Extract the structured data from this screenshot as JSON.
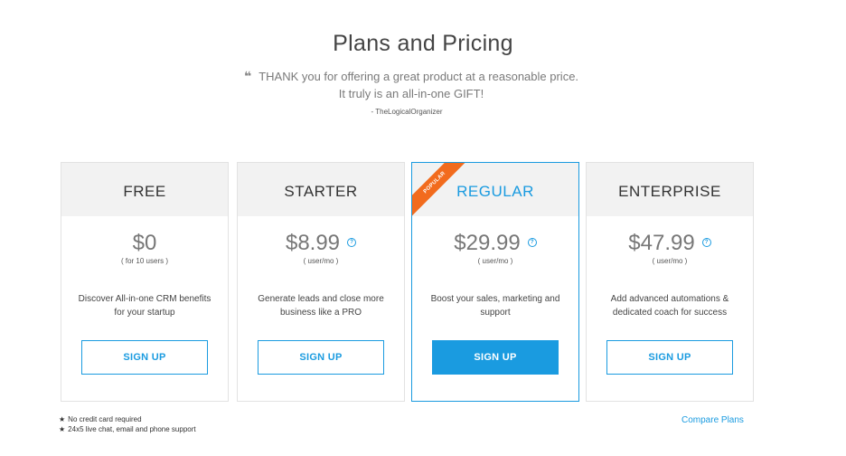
{
  "page": {
    "title": "Plans and Pricing"
  },
  "testimonial": {
    "quote": "THANK you for offering a great product at a reasonable price. It truly is an all-in-one GIFT!",
    "author": "- TheLogicalOrganizer",
    "icon": "quote-icon"
  },
  "plans": [
    {
      "name": "FREE",
      "price": "$0",
      "unit": "( for 10 users )",
      "description": "Discover All-in-one CRM benefits for your startup",
      "cta": "SIGN UP",
      "featured": false
    },
    {
      "name": "STARTER",
      "price": "$8.99",
      "unit": "( user/mo )",
      "description": "Generate leads and close more business like a PRO",
      "cta": "SIGN UP",
      "featured": false
    },
    {
      "name": "REGULAR",
      "price": "$29.99",
      "unit": "( user/mo )",
      "description": "Boost your sales, marketing and support",
      "cta": "SIGN UP",
      "featured": true,
      "badge": "POPULAR"
    },
    {
      "name": "ENTERPRISE",
      "price": "$47.99",
      "unit": "( user/mo )",
      "description": "Add advanced automations & dedicated coach for success",
      "cta": "SIGN UP",
      "featured": false
    }
  ],
  "help_icon_glyph": "?",
  "footnotes": [
    "No credit card required",
    "24x5 live chat, email and phone support"
  ],
  "compare_link": "Compare Plans",
  "colors": {
    "accent": "#1a9be0",
    "badge": "#f26b1d",
    "card_header_bg": "#f2f2f2"
  }
}
